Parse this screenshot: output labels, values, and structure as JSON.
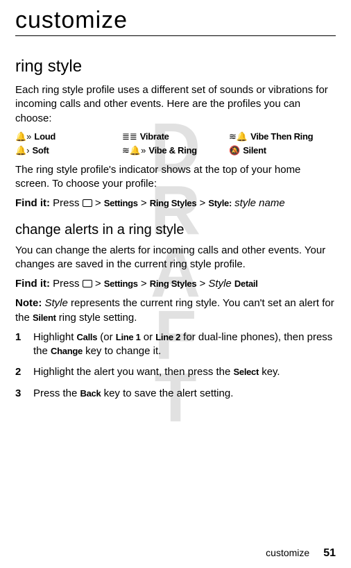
{
  "watermark": "DRAFT",
  "header": {
    "title": "customize"
  },
  "section1": {
    "heading": "ring style",
    "intro": "Each ring style profile uses a different set of sounds or vibrations for incoming calls and other events. Here are the profiles you can choose:",
    "styles": {
      "row1": {
        "a": "Loud",
        "b": "Vibrate",
        "c": "Vibe Then Ring"
      },
      "row2": {
        "a": "Soft",
        "b": "Vibe & Ring",
        "c": "Silent"
      }
    },
    "after_table": "The ring style profile's indicator shows at the top of your home screen. To choose your profile:",
    "findit_prefix": "Find it:",
    "findit_press": "Press",
    "path1": "Settings",
    "path2": "Ring Styles",
    "path3": "Style:",
    "path_tail": "style name"
  },
  "section2": {
    "heading": "change alerts in a ring style",
    "intro": "You can change the alerts for incoming calls and other events. Your changes are saved in the current ring style profile.",
    "findit_prefix": "Find it:",
    "findit_press": "Press",
    "path1": "Settings",
    "path2": "Ring Styles",
    "path_style": "Style",
    "path_detail": "Detail",
    "note_label": "Note:",
    "note_style": "Style",
    "note_rest": " represents the current ring style. You can't set an alert for the ",
    "note_silent": "Silent",
    "note_end": " ring style setting."
  },
  "steps": {
    "s1": {
      "num": "1",
      "a": "Highlight ",
      "b": "Calls",
      "c": " (or ",
      "d": "Line 1",
      "e": " or ",
      "f": "Line 2",
      "g": " for dual-line phones), then press the ",
      "h": "Change",
      "i": " key to change it."
    },
    "s2": {
      "num": "2",
      "a": "Highlight the alert you want, then press the ",
      "b": "Select",
      "c": " key."
    },
    "s3": {
      "num": "3",
      "a": "Press the ",
      "b": "Back",
      "c": " key to save the alert setting."
    }
  },
  "footer": {
    "section": "customize",
    "page": "51"
  },
  "icons": {
    "loud": "🔔»",
    "vibrate": "📳",
    "vibe_then_ring": "≋🔔",
    "soft": "🔔›",
    "vibe_and_ring": "≋🔔»",
    "silent": "🔕"
  },
  "gt": ">"
}
